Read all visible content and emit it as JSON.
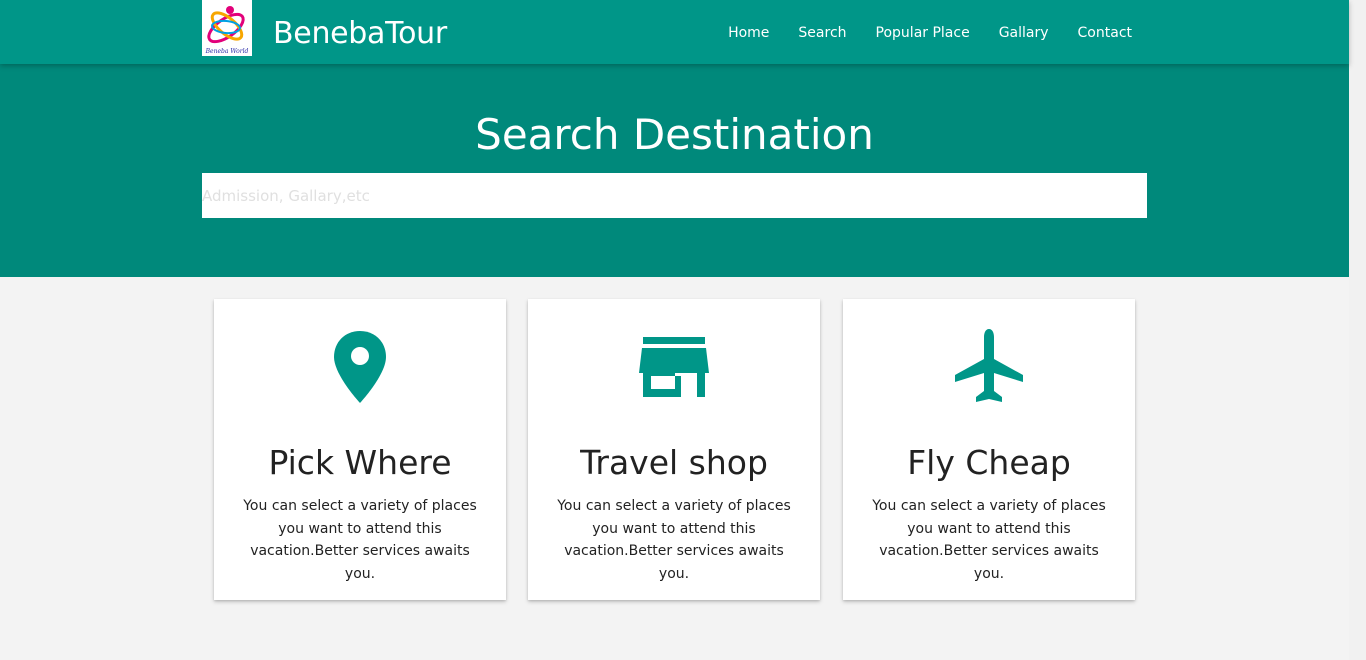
{
  "navbar": {
    "brand": "BenebaTour",
    "logo_text": "Beneba World",
    "links": [
      "Home",
      "Search",
      "Popular Place",
      "Gallary",
      "Contact"
    ]
  },
  "hero": {
    "title": "Search Destination",
    "search_placeholder": "Admission, Gallary,etc",
    "search_value": ""
  },
  "cards": [
    {
      "icon": "map-pin-icon",
      "title": "Pick Where",
      "text": "You can select a variety of places you want to attend this vacation.Better services awaits you."
    },
    {
      "icon": "store-icon",
      "title": "Travel shop",
      "text": "You can select a variety of places you want to attend this vacation.Better services awaits you."
    },
    {
      "icon": "airplane-icon",
      "title": "Fly Cheap",
      "text": "You can select a variety of places you want to attend this vacation.Better services awaits you."
    }
  ],
  "colors": {
    "navbar": "#009688",
    "hero": "#00897b",
    "accent": "#009688",
    "page_background": "#f3f3f3"
  }
}
